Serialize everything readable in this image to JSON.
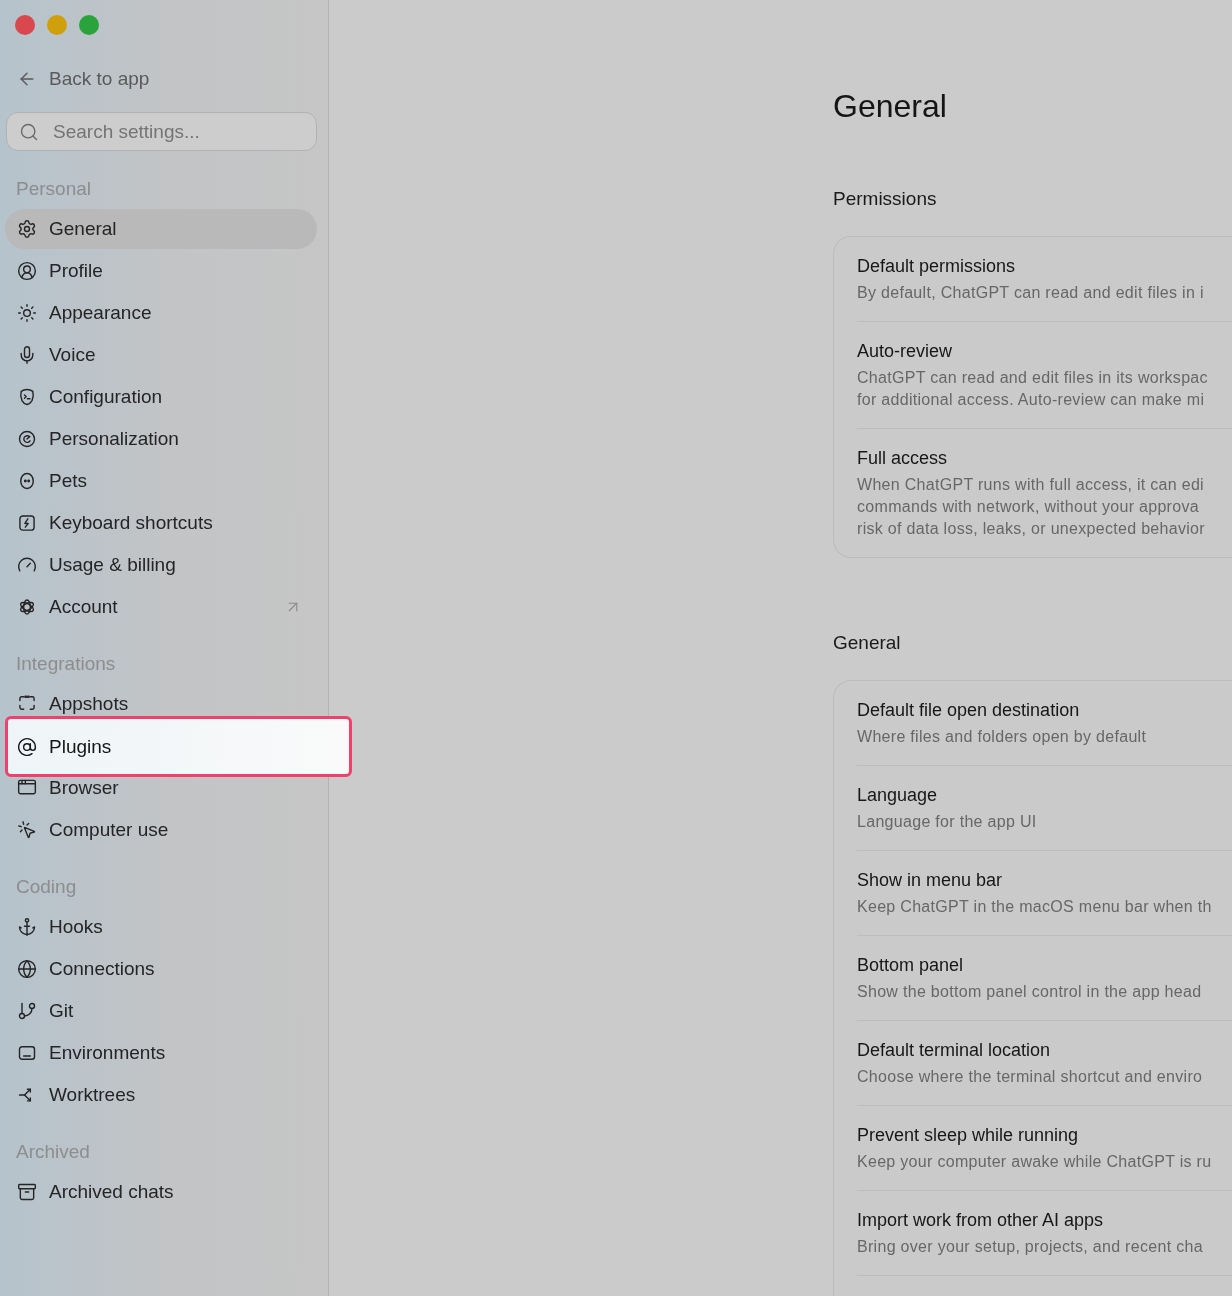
{
  "window": {
    "controls": [
      {
        "kind": "close"
      },
      {
        "kind": "minimize"
      },
      {
        "kind": "zoom"
      }
    ]
  },
  "sidebar": {
    "back_link": "Back to app",
    "search": {
      "placeholder": "Search settings..."
    },
    "sections": [
      {
        "title": "Personal",
        "items": [
          {
            "label": "General",
            "selected": true,
            "highlighted": false,
            "external": false
          },
          {
            "label": "Profile",
            "selected": false,
            "highlighted": false,
            "external": false
          },
          {
            "label": "Appearance",
            "selected": false,
            "highlighted": false,
            "external": false
          },
          {
            "label": "Voice",
            "selected": false,
            "highlighted": false,
            "external": false
          },
          {
            "label": "Configuration",
            "selected": false,
            "highlighted": false,
            "external": false
          },
          {
            "label": "Personalization",
            "selected": false,
            "highlighted": false,
            "external": false
          },
          {
            "label": "Pets",
            "selected": false,
            "highlighted": false,
            "external": false
          },
          {
            "label": "Keyboard shortcuts",
            "selected": false,
            "highlighted": false,
            "external": false
          },
          {
            "label": "Usage & billing",
            "selected": false,
            "highlighted": false,
            "external": false
          },
          {
            "label": "Account",
            "selected": false,
            "highlighted": false,
            "external": true
          }
        ]
      },
      {
        "title": "Integrations",
        "items": [
          {
            "label": "Appshots",
            "selected": false,
            "highlighted": false,
            "external": false
          },
          {
            "label": "Plugins",
            "selected": false,
            "highlighted": true,
            "external": false
          },
          {
            "label": "Browser",
            "selected": false,
            "highlighted": false,
            "external": false
          },
          {
            "label": "Computer use",
            "selected": false,
            "highlighted": false,
            "external": false
          }
        ]
      },
      {
        "title": "Coding",
        "items": [
          {
            "label": "Hooks",
            "selected": false,
            "highlighted": false,
            "external": false
          },
          {
            "label": "Connections",
            "selected": false,
            "highlighted": false,
            "external": false
          },
          {
            "label": "Git",
            "selected": false,
            "highlighted": false,
            "external": false
          },
          {
            "label": "Environments",
            "selected": false,
            "highlighted": false,
            "external": false
          },
          {
            "label": "Worktrees",
            "selected": false,
            "highlighted": false,
            "external": false
          }
        ]
      },
      {
        "title": "Archived",
        "items": [
          {
            "label": "Archived chats",
            "selected": false,
            "highlighted": false,
            "external": false
          }
        ]
      }
    ]
  },
  "page": {
    "title": "General",
    "sections": [
      {
        "title": "Permissions",
        "cut_off": false,
        "rows": [
          {
            "title": "Default permissions",
            "description": [
              "By default, ChatGPT can read and edit files in i"
            ]
          },
          {
            "title": "Auto-review",
            "description": [
              "ChatGPT can read and edit files in its workspac",
              "for additional access. Auto-review can make mi"
            ]
          },
          {
            "title": "Full access",
            "description": [
              "When ChatGPT runs with full access, it can edi",
              "commands with network, without your approva",
              "risk of data loss, leaks, or unexpected behavior"
            ]
          }
        ]
      },
      {
        "title": "General",
        "cut_off": true,
        "rows": [
          {
            "title": "Default file open destination",
            "description": [
              "Where files and folders open by default"
            ]
          },
          {
            "title": "Language",
            "description": [
              "Language for the app UI"
            ]
          },
          {
            "title": "Show in menu bar",
            "description": [
              "Keep ChatGPT in the macOS menu bar when th"
            ]
          },
          {
            "title": "Bottom panel",
            "description": [
              "Show the bottom panel control in the app head"
            ]
          },
          {
            "title": "Default terminal location",
            "description": [
              "Choose where the terminal shortcut and enviro"
            ]
          },
          {
            "title": "Prevent sleep while running",
            "description": [
              "Keep your computer awake while ChatGPT is ru"
            ]
          },
          {
            "title": "Import work from other AI apps",
            "description": [
              "Bring over your setup, projects, and recent cha"
            ]
          }
        ]
      }
    ]
  }
}
